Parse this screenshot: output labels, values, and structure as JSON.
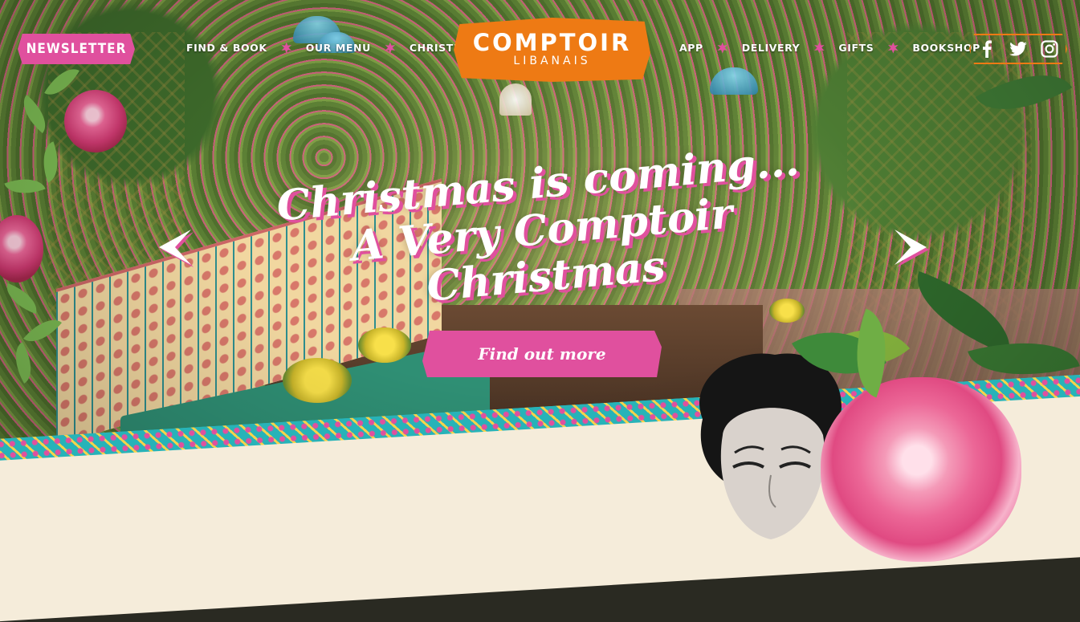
{
  "header": {
    "newsletter_label": "NEWSLETTER",
    "nav_left": [
      "FIND & BOOK",
      "OUR MENU",
      "CHRISTMAS"
    ],
    "nav_right": [
      "APP",
      "DELIVERY",
      "GIFTS",
      "BOOKSHOP"
    ],
    "logo": {
      "line1": "COMPTOIR",
      "line2": "LIBANAIS"
    },
    "social": [
      "facebook-icon",
      "twitter-icon",
      "instagram-icon"
    ]
  },
  "hero": {
    "headline": [
      "Christmas is coming...",
      "A Very Comptoir",
      "Christmas"
    ],
    "cta_label": "Find out more"
  },
  "colors": {
    "accent_pink": "#e0509e",
    "logo_orange": "#ee7a14",
    "tile_teal": "#27b3b8",
    "paper": "#f5ecda"
  }
}
